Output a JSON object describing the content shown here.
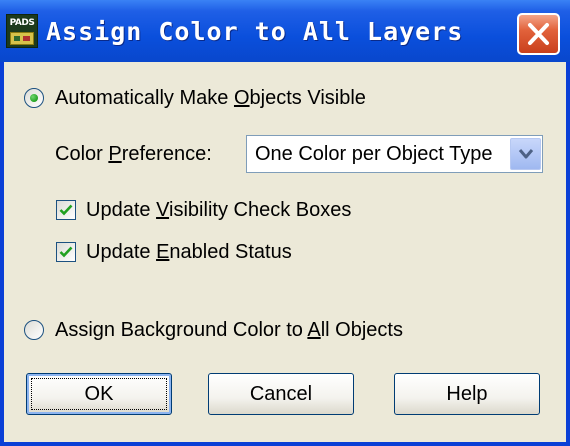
{
  "window": {
    "title": "Assign Color to All Layers",
    "app_icon_text": "PADS",
    "close_icon": "close-icon"
  },
  "options": {
    "auto_visible": {
      "pre": "Automatically Make ",
      "mnemonic": "O",
      "post": "bjects Visible",
      "selected": true
    },
    "color_preference": {
      "label_pre": "Color ",
      "mnemonic": "P",
      "label_post": "reference:",
      "value": "One Color per Object Type"
    },
    "update_visibility": {
      "pre": "Update ",
      "mnemonic": "V",
      "post": "isibility Check Boxes",
      "checked": true
    },
    "update_enabled": {
      "pre": "Update ",
      "mnemonic": "E",
      "post": "nabled Status",
      "checked": true
    },
    "background_color": {
      "pre": "Assign Background Color to ",
      "mnemonic": "A",
      "post": "ll Objects",
      "selected": false
    }
  },
  "buttons": {
    "ok": "OK",
    "cancel": "Cancel",
    "help": "Help"
  },
  "colors": {
    "titlebar": "#0a4fdc",
    "close_button": "#e2623b",
    "dialog_face": "#ece9d8",
    "check_mark": "#21a121"
  }
}
